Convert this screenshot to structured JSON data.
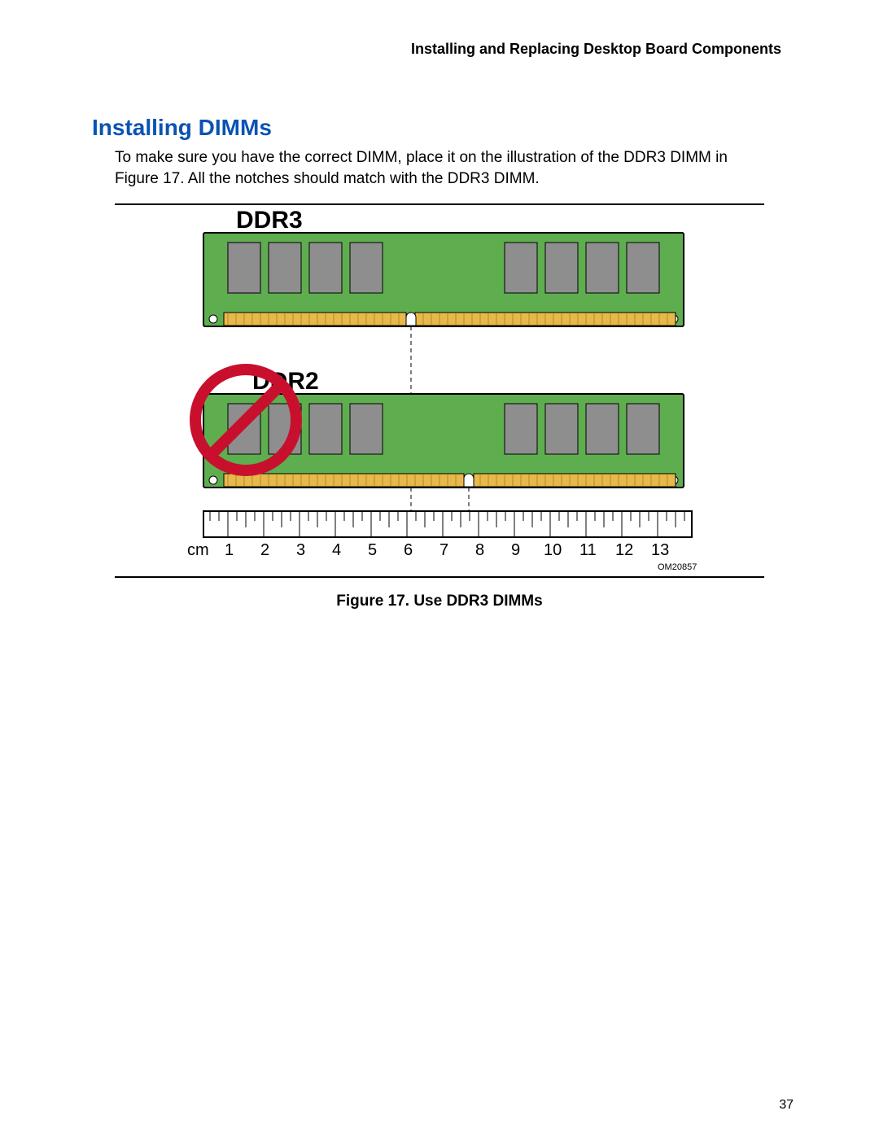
{
  "header": "Installing and Replacing Desktop Board Components",
  "section_title": "Installing DIMMs",
  "paragraph": "To make sure you have the correct DIMM, place it on the illustration of the DDR3 DIMM in Figure 17.  All the notches should match with the DDR3 DIMM.",
  "figure": {
    "caption": "Figure 17.  Use DDR3 DIMMs",
    "labels": {
      "ddr3": "DDR3",
      "ddr2": "DDR2"
    },
    "ruler_unit": "cm",
    "ruler_values": [
      "1",
      "2",
      "3",
      "4",
      "5",
      "6",
      "7",
      "8",
      "9",
      "10",
      "11",
      "12",
      "13"
    ],
    "om_id": "OM20857"
  },
  "page_number": "37"
}
